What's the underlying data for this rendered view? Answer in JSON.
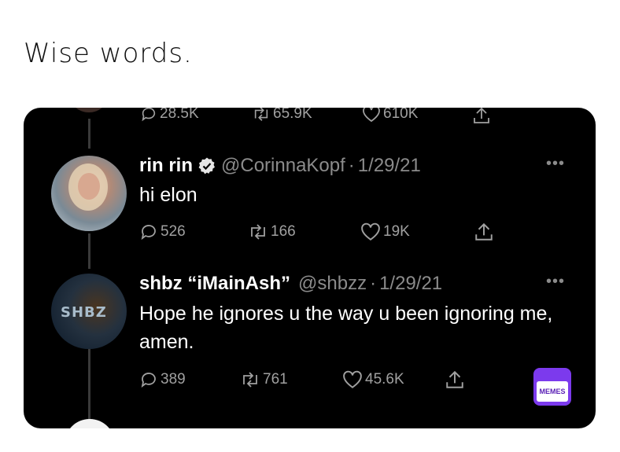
{
  "caption": "Wise words.",
  "partial_tweet": {
    "replies": "28.5K",
    "retweets": "65.9K",
    "likes": "610K"
  },
  "tweets": [
    {
      "name": "rin rin",
      "verified": true,
      "handle": "@CorinnaKopf",
      "date": "1/29/21",
      "text": "hi elon",
      "replies": "526",
      "retweets": "166",
      "likes": "19K"
    },
    {
      "name": "shbz “iMainAsh”",
      "verified": false,
      "handle": "@shbzz",
      "date": "1/29/21",
      "text": "Hope he ignores u the way u been ignoring me, amen.",
      "replies": "389",
      "retweets": "761",
      "likes": "45.6K",
      "avatar_label": "SHBZ"
    }
  ],
  "watermark": "MEMES",
  "colors": {
    "background": "#000000",
    "text": "#ffffff",
    "muted": "#8b8b8b",
    "verified": "#e0e0e0",
    "watermark": "#7c3aed"
  },
  "icons": [
    "reply-icon",
    "retweet-icon",
    "like-icon",
    "share-icon",
    "verified-badge-icon",
    "more-icon"
  ]
}
